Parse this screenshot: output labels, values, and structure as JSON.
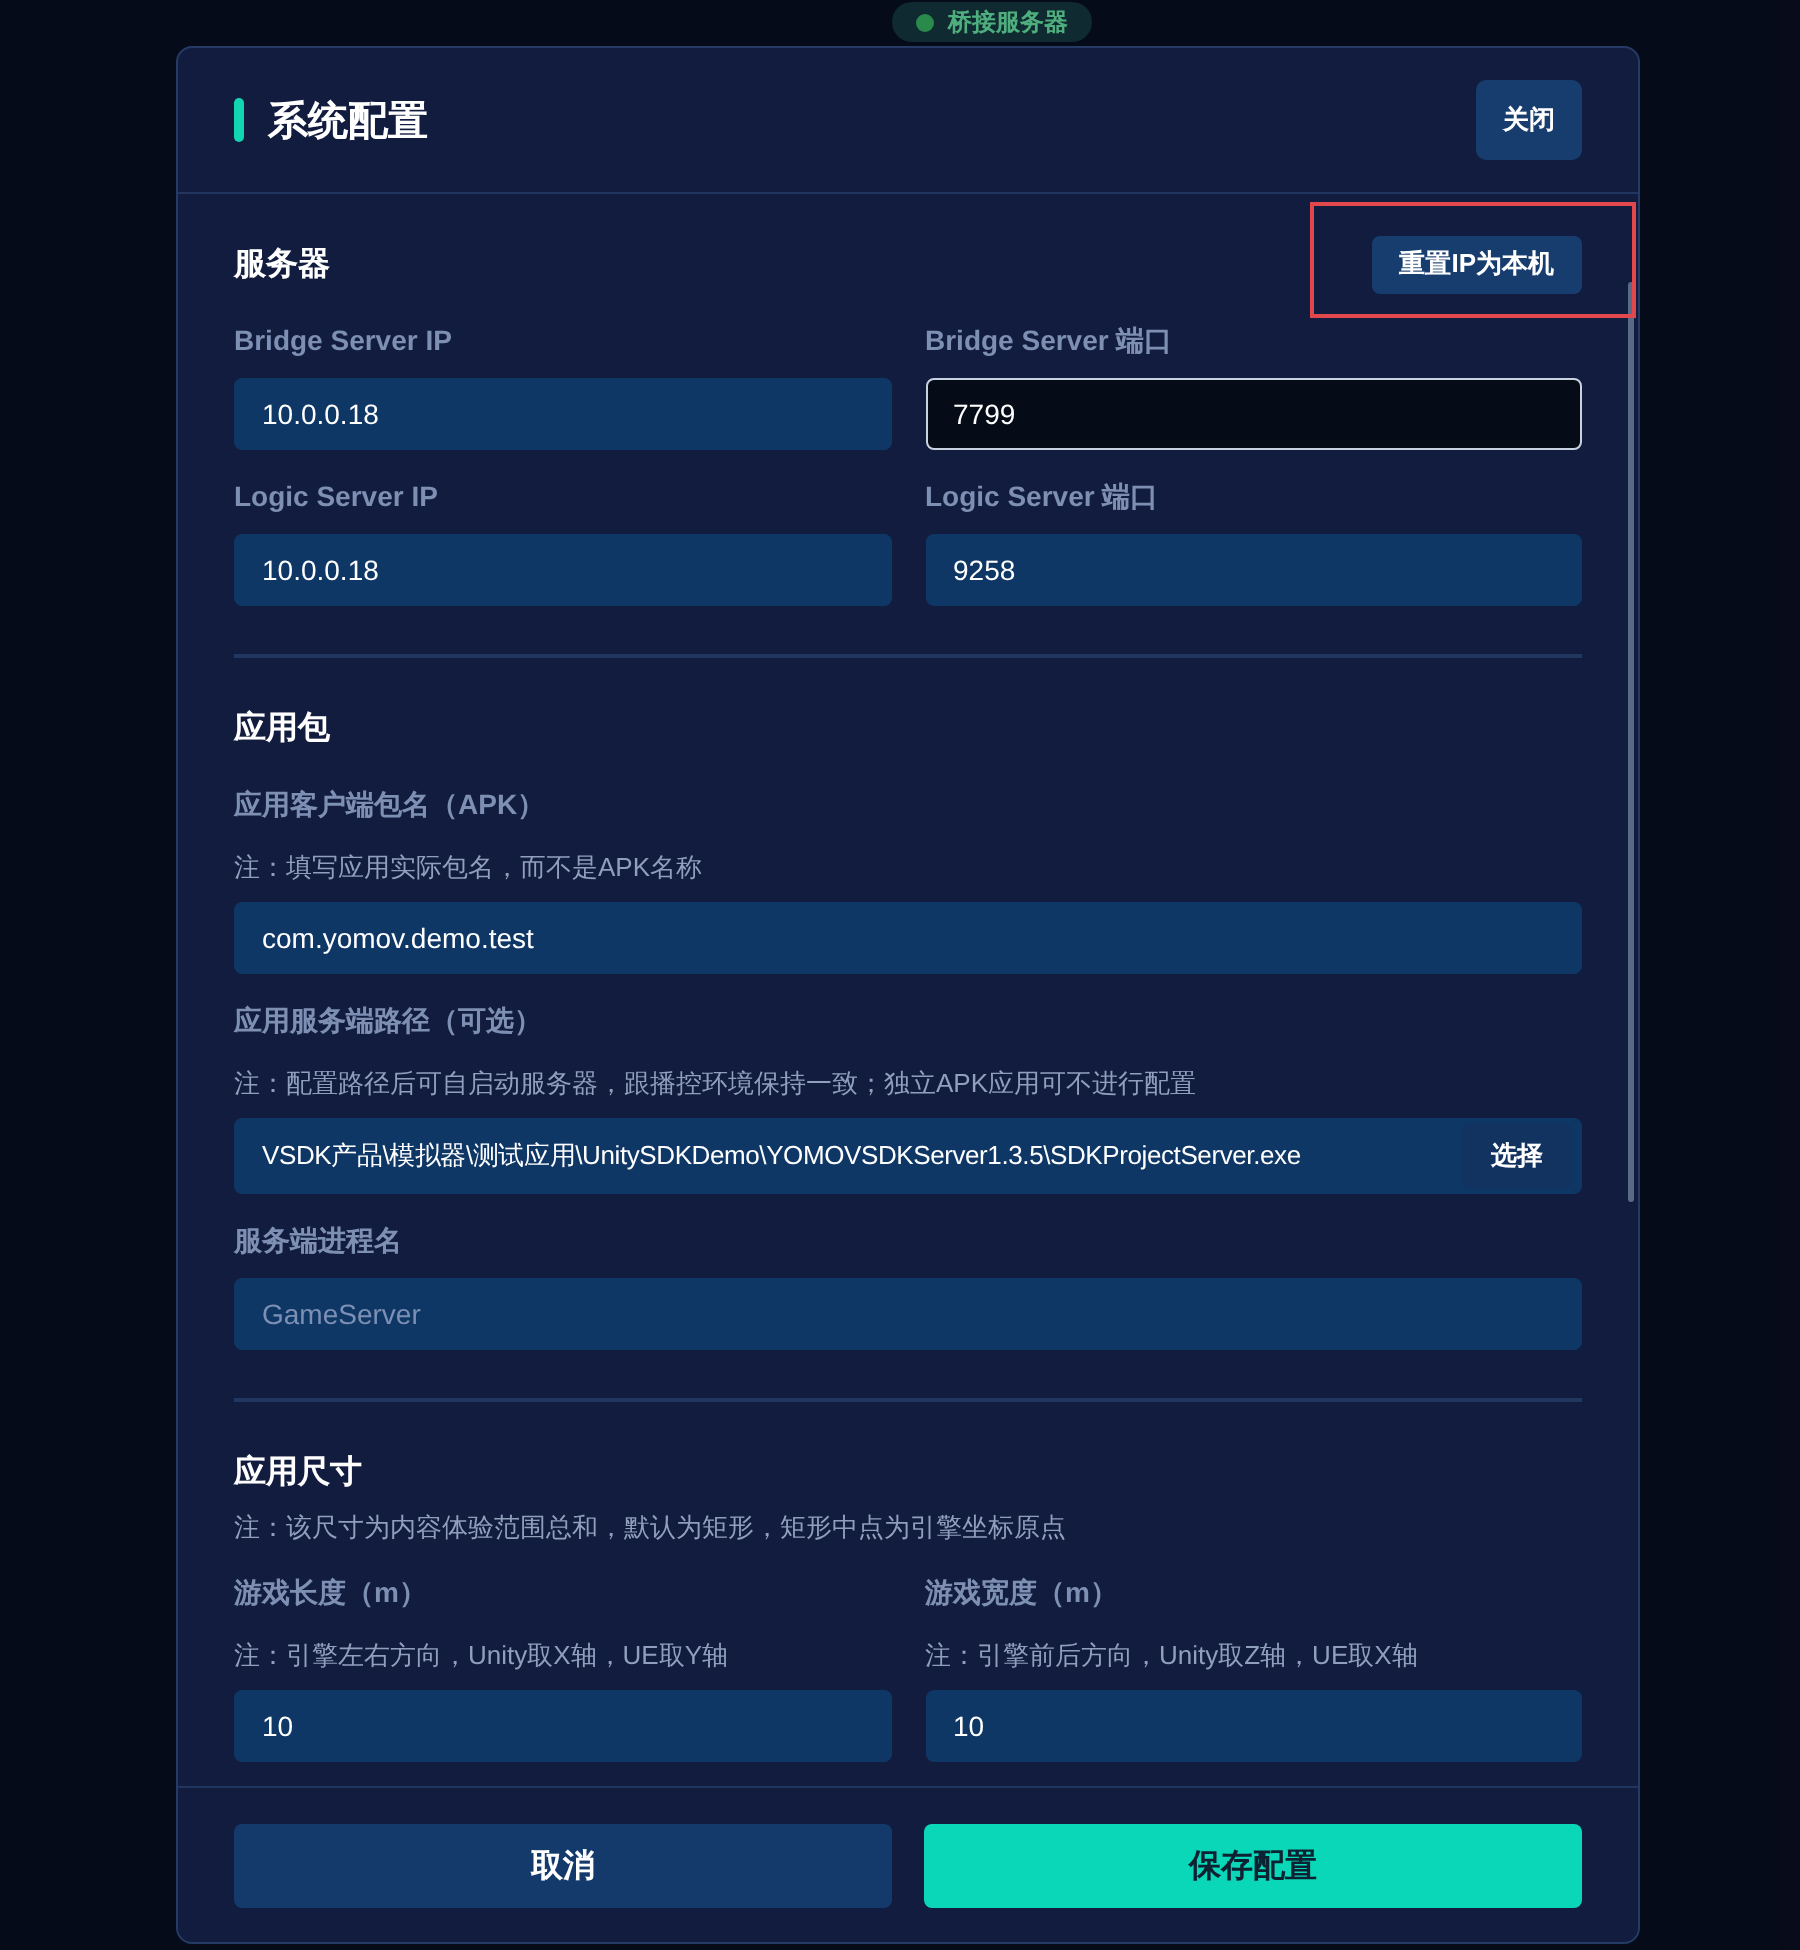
{
  "background": {
    "status": "桥接服务器"
  },
  "dialog": {
    "title": "系统配置",
    "close": "关闭"
  },
  "sections": [
    {
      "title": "服务器",
      "action": {
        "label": "重置IP为本机",
        "highlighted": true
      },
      "rows": [
        [
          {
            "label": "Bridge Server IP",
            "value": "10.0.0.18",
            "focused": false
          },
          {
            "label": "Bridge Server 端口",
            "value": "7799",
            "focused": true
          }
        ],
        [
          {
            "label": "Logic Server IP",
            "value": "10.0.0.18",
            "focused": false
          },
          {
            "label": "Logic Server 端口",
            "value": "9258",
            "focused": false
          }
        ]
      ]
    },
    {
      "title": "应用包",
      "rows": [
        [
          {
            "label": "应用客户端包名（APK）",
            "note": "注：填写应用实际包名，而不是APK名称",
            "value": "com.yomov.demo.test",
            "focused": false
          }
        ],
        [
          {
            "label": "应用服务端路径（可选）",
            "note": "注：配置路径后可自启动服务器，跟播控环境保持一致；独立APK应用可不进行配置",
            "value": "VSDK产品\\模拟器\\测试应用\\UnitySDKDemo\\YOMOVSDKServer1.3.5\\SDKProjectServer.exe",
            "button": "选择",
            "focused": false
          }
        ],
        [
          {
            "label": "服务端进程名",
            "placeholder": "GameServer",
            "focused": false
          }
        ]
      ]
    },
    {
      "title": "应用尺寸",
      "note": "注：该尺寸为内容体验范围总和，默认为矩形，矩形中点为引擎坐标原点",
      "rows": [
        [
          {
            "label": "游戏长度（m）",
            "note": "注：引擎左右方向，Unity取X轴，UE取Y轴",
            "value": "10",
            "focused": false
          },
          {
            "label": "游戏宽度（m）",
            "note": "注：引擎前后方向，Unity取Z轴，UE取X轴",
            "value": "10",
            "focused": false
          }
        ]
      ]
    }
  ],
  "footer": {
    "cancel": "取消",
    "save": "保存配置"
  }
}
